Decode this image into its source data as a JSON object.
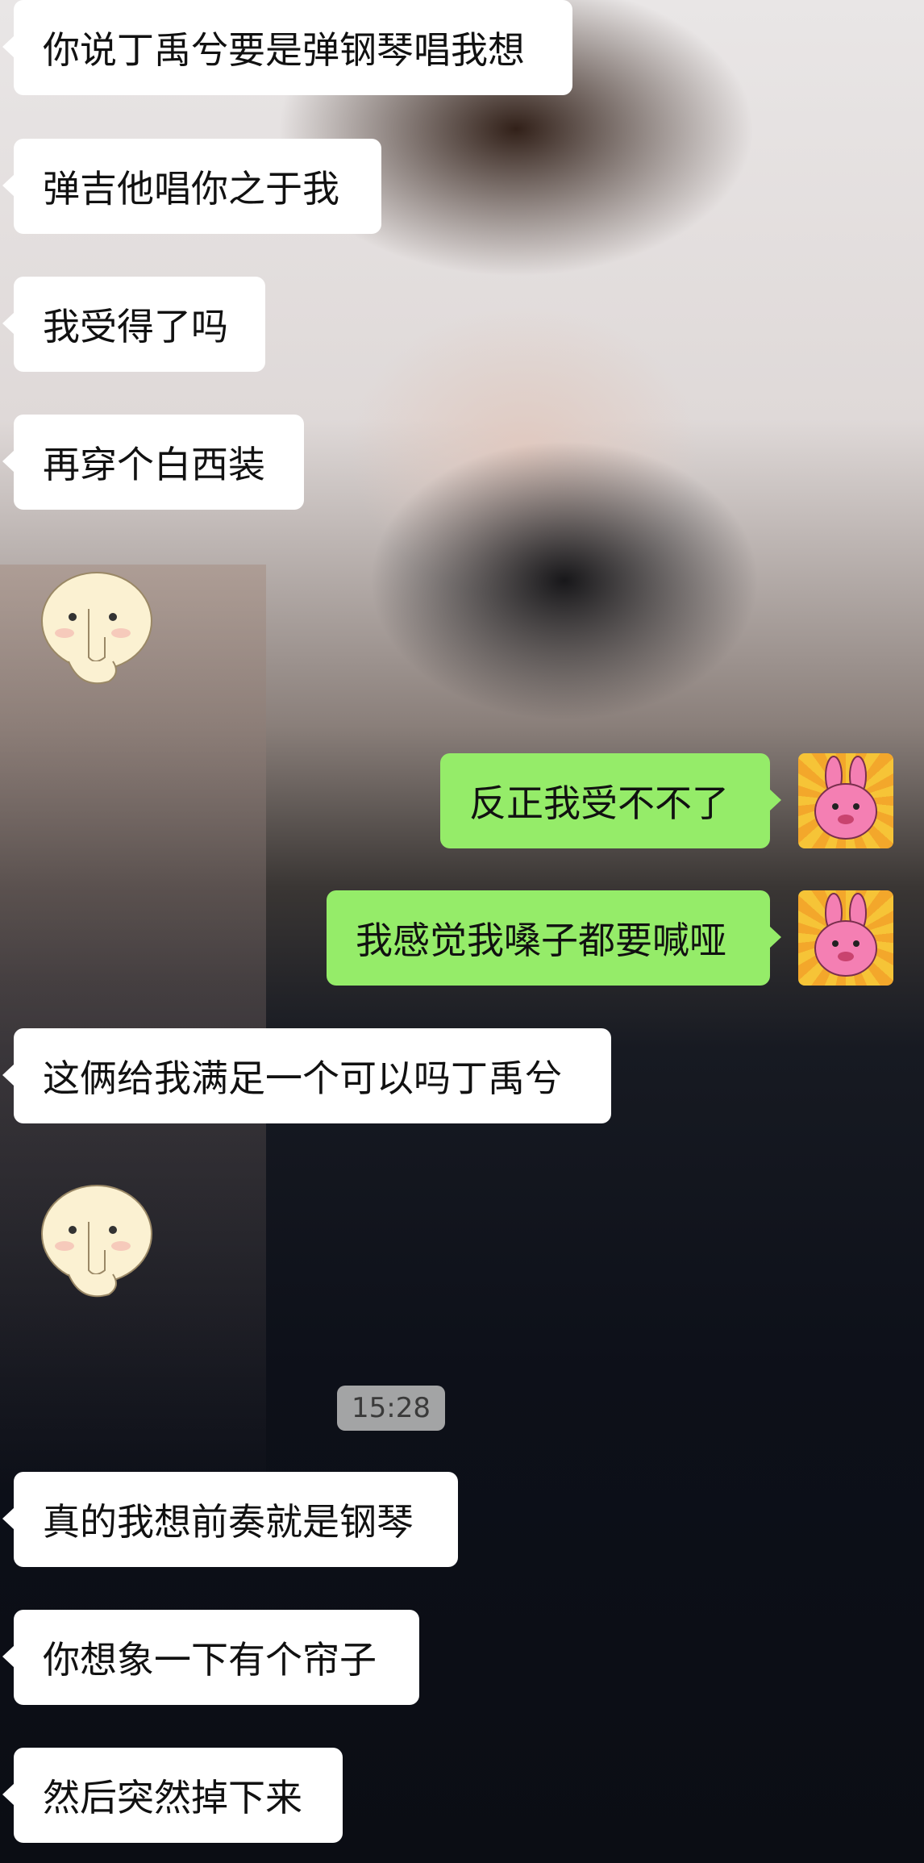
{
  "messages_top": [
    {
      "side": "left",
      "text": "你说丁禹兮要是弹钢琴唱我想"
    },
    {
      "side": "left",
      "text": "弹吉他唱你之于我"
    },
    {
      "side": "left",
      "text": "我受得了吗"
    },
    {
      "side": "left",
      "text": "再穿个白西装"
    },
    {
      "side": "left",
      "type": "sticker",
      "icon": "bun-covering-mouth-sticker"
    }
  ],
  "messages_mid": [
    {
      "side": "right",
      "text": "反正我受不不了",
      "avatar": "pink-bunny-avatar"
    },
    {
      "side": "right",
      "text": "我感觉我嗓子都要喊哑",
      "avatar": "pink-bunny-avatar"
    },
    {
      "side": "left",
      "text": "这俩给我满足一个可以吗丁禹兮"
    },
    {
      "side": "left",
      "type": "sticker",
      "icon": "bun-covering-mouth-sticker"
    }
  ],
  "timestamp": "15:28",
  "messages_bottom": [
    {
      "side": "left",
      "text": "真的我想前奏就是钢琴"
    },
    {
      "side": "left",
      "text": "你想象一下有个帘子"
    },
    {
      "side": "left",
      "text": "然后突然掉下来"
    }
  ],
  "colors": {
    "incoming_bubble": "#ffffff",
    "outgoing_bubble": "#95ec69",
    "timestamp_pill": "#bebebe"
  }
}
